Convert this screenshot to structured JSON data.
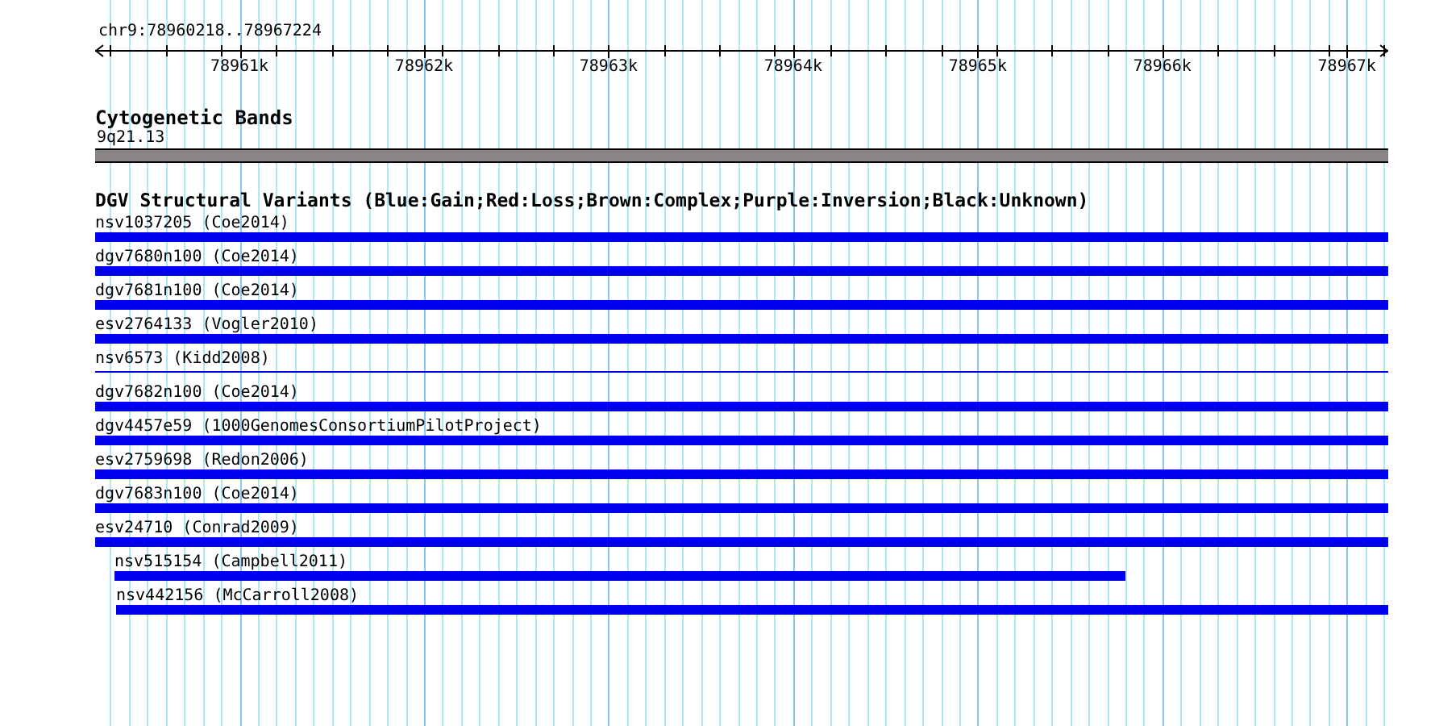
{
  "ruler": {
    "title": "chr9:78960218..78967224",
    "ticks": [
      {
        "label": "78961k"
      },
      {
        "label": "78962k"
      },
      {
        "label": "78963k"
      },
      {
        "label": "78964k"
      },
      {
        "label": "78965k"
      },
      {
        "label": "78966k"
      },
      {
        "label": "78967k"
      }
    ]
  },
  "cytoband_track": {
    "title": "Cytogenetic Bands",
    "band": {
      "label": "9q21.13"
    }
  },
  "variant_track": {
    "title": "DGV Structural Variants (Blue:Gain;Red:Loss;Brown:Complex;Purple:Inversion;Black:Unknown)",
    "variants": [
      {
        "label": "nsv1037205 (Coe2014)",
        "color": "#0000ee",
        "kind": "bar"
      },
      {
        "label": "dgv7680n100 (Coe2014)",
        "color": "#0000ee",
        "kind": "bar"
      },
      {
        "label": "dgv7681n100 (Coe2014)",
        "color": "#0000ee",
        "kind": "bar"
      },
      {
        "label": "esv2764133 (Vogler2010)",
        "color": "#0000ee",
        "kind": "bar"
      },
      {
        "label": "nsv6573 (Kidd2008)",
        "color": "#0000ee",
        "kind": "line"
      },
      {
        "label": "dgv7682n100 (Coe2014)",
        "color": "#0000ee",
        "kind": "bar"
      },
      {
        "label": "dgv4457e59 (1000GenomesConsortiumPilotProject)",
        "color": "#0000ee",
        "kind": "bar"
      },
      {
        "label": "esv2759698 (Redon2006)",
        "color": "#0000ee",
        "kind": "bar"
      },
      {
        "label": "dgv7683n100 (Coe2014)",
        "color": "#0000ee",
        "kind": "bar"
      },
      {
        "label": "esv24710 (Conrad2009)",
        "color": "#0000ee",
        "kind": "bar"
      },
      {
        "label": "nsv515154 (Campbell2011)",
        "color": "#0000ee",
        "kind": "bar"
      },
      {
        "label": "nsv442156 (McCarroll2008)",
        "color": "#0000ee",
        "kind": "bar"
      }
    ]
  }
}
